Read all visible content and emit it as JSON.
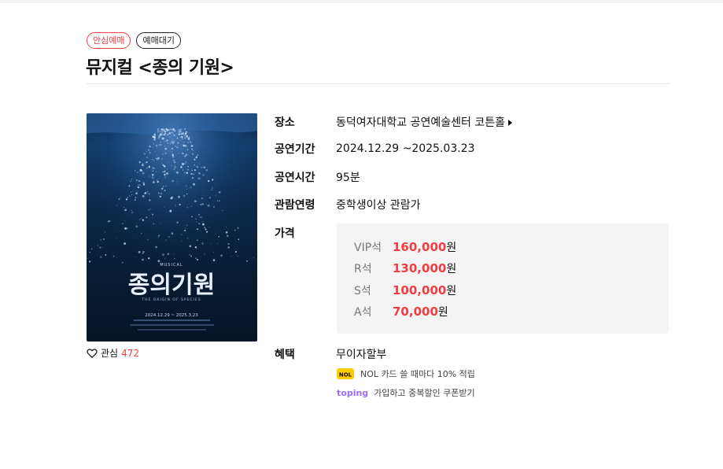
{
  "badges": {
    "safe": "안심예매",
    "wait": "예매대기"
  },
  "title": "뮤지컬 <종의 기원>",
  "poster": {
    "small_top": "MUSICAL",
    "main_title": "종의기원",
    "subtitle": "THE ORIGIN OF SPECIES",
    "dates": "2024.12.29 ~ 2025.3.23"
  },
  "like": {
    "label": "관심",
    "count": "472"
  },
  "info": {
    "venue_label": "장소",
    "venue_value": "동덕여자대학교 공연예술센터 코튼홀",
    "period_label": "공연기간",
    "period_value": "2024.12.29 ~2025.03.23",
    "runtime_label": "공연시간",
    "runtime_value": "95분",
    "age_label": "관람연령",
    "age_value": "중학생이상 관람가",
    "price_label": "가격",
    "benefit_label": "혜택",
    "benefit_value": "무이자할부"
  },
  "prices": [
    {
      "grade": "VIP석",
      "amount": "160,000",
      "unit": "원"
    },
    {
      "grade": "R석",
      "amount": "130,000",
      "unit": "원"
    },
    {
      "grade": "S석",
      "amount": "100,000",
      "unit": "원"
    },
    {
      "grade": "A석",
      "amount": "70,000",
      "unit": "원"
    }
  ],
  "benefits": {
    "nol_logo": "NOL",
    "nol_text": "NOL 카드 쓸 때마다 10% 적립",
    "toping_logo": "toping",
    "toping_text": "가입하고 중복할인 쿠폰받기"
  },
  "colors": {
    "accent": "#ef3e42",
    "price_bg": "#f4f4f4",
    "toping": "#9b6cf2"
  }
}
